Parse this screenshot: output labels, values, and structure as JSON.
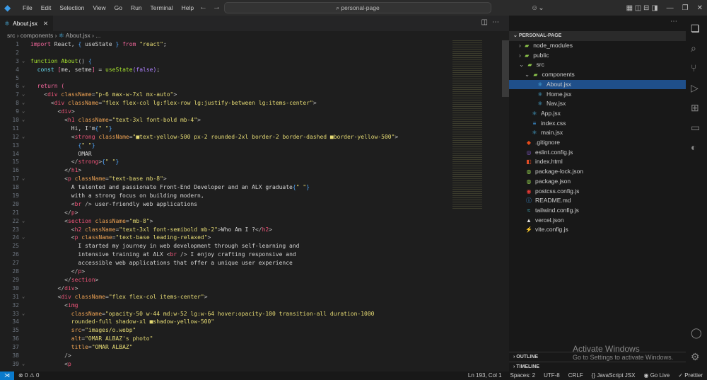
{
  "menu": [
    "File",
    "Edit",
    "Selection",
    "View",
    "Go",
    "Run",
    "Terminal",
    "Help"
  ],
  "search": "personal-page",
  "tab": {
    "label": "About.jsx"
  },
  "breadcrumb": [
    "src",
    "components",
    "About.jsx",
    "..."
  ],
  "code": [
    [
      [
        "k",
        "import"
      ],
      [
        "x",
        " React, "
      ],
      [
        "b",
        "{"
      ],
      [
        "x",
        " useState "
      ],
      [
        "b",
        "}"
      ],
      [
        "x",
        " "
      ],
      [
        "k",
        "from"
      ],
      [
        "x",
        " "
      ],
      [
        "s",
        "\"react\""
      ],
      [
        "x",
        ";"
      ]
    ],
    [],
    [
      [
        "f",
        "function"
      ],
      [
        "x",
        " "
      ],
      [
        "f",
        "About"
      ],
      [
        "p",
        "() "
      ],
      [
        "b",
        "{"
      ]
    ],
    [
      [
        "x",
        "  "
      ],
      [
        "c",
        "const"
      ],
      [
        "x",
        " "
      ],
      [
        "k",
        "["
      ],
      [
        "x",
        "me, setme"
      ],
      [
        "k",
        "]"
      ],
      [
        "x",
        " = "
      ],
      [
        "f",
        "useState"
      ],
      [
        "v",
        "("
      ],
      [
        "v",
        "false"
      ],
      [
        "v",
        ")"
      ],
      [
        "x",
        ";"
      ]
    ],
    [],
    [
      [
        "x",
        "  "
      ],
      [
        "k",
        "return"
      ],
      [
        "x",
        " "
      ],
      [
        "k",
        "("
      ]
    ],
    [
      [
        "x",
        "    "
      ],
      [
        "p",
        "<"
      ],
      [
        "t",
        "div"
      ],
      [
        "x",
        " "
      ],
      [
        "a",
        "className"
      ],
      [
        "p",
        "="
      ],
      [
        "s",
        "\"p-6 max-w-7xl mx-auto\""
      ],
      [
        "p",
        ">"
      ]
    ],
    [
      [
        "x",
        "      "
      ],
      [
        "p",
        "<"
      ],
      [
        "t",
        "div"
      ],
      [
        "x",
        " "
      ],
      [
        "a",
        "className"
      ],
      [
        "p",
        "="
      ],
      [
        "s",
        "\"flex flex-col lg:flex-row lg:justify-between lg:items-center\""
      ],
      [
        "p",
        ">"
      ]
    ],
    [
      [
        "x",
        "        "
      ],
      [
        "p",
        "<"
      ],
      [
        "t",
        "div"
      ],
      [
        "p",
        ">"
      ]
    ],
    [
      [
        "x",
        "          "
      ],
      [
        "p",
        "<"
      ],
      [
        "t",
        "h1"
      ],
      [
        "x",
        " "
      ],
      [
        "a",
        "className"
      ],
      [
        "p",
        "="
      ],
      [
        "s",
        "\"text-3xl font-bold mb-4\""
      ],
      [
        "p",
        ">"
      ]
    ],
    [
      [
        "x",
        "            Hi, I'm"
      ],
      [
        "b",
        "{"
      ],
      [
        "s",
        "\" \""
      ],
      [
        "b",
        "}"
      ]
    ],
    [
      [
        "x",
        "            "
      ],
      [
        "p",
        "<"
      ],
      [
        "t",
        "strong"
      ],
      [
        "x",
        " "
      ],
      [
        "a",
        "className"
      ],
      [
        "p",
        "="
      ],
      [
        "s",
        "\"■text-yellow-500 px-2 rounded-2xl border-2 border-dashed ■border-yellow-500\""
      ],
      [
        "p",
        ">"
      ]
    ],
    [
      [
        "x",
        "              "
      ],
      [
        "b",
        "{"
      ],
      [
        "s",
        "\" \""
      ],
      [
        "b",
        "}"
      ]
    ],
    [
      [
        "x",
        "              OMAR"
      ]
    ],
    [
      [
        "x",
        "            "
      ],
      [
        "p",
        "</"
      ],
      [
        "t",
        "strong"
      ],
      [
        "p",
        ">"
      ],
      [
        "b",
        "{"
      ],
      [
        "s",
        "\" \""
      ],
      [
        "b",
        "}"
      ]
    ],
    [
      [
        "x",
        "          "
      ],
      [
        "p",
        "</"
      ],
      [
        "t",
        "h1"
      ],
      [
        "p",
        ">"
      ]
    ],
    [
      [
        "x",
        "          "
      ],
      [
        "p",
        "<"
      ],
      [
        "t",
        "p"
      ],
      [
        "x",
        " "
      ],
      [
        "a",
        "className"
      ],
      [
        "p",
        "="
      ],
      [
        "s",
        "\"text-base mb-8\""
      ],
      [
        "p",
        ">"
      ]
    ],
    [
      [
        "x",
        "            A talented and passionate Front-End Developer and an ALX graduate"
      ],
      [
        "b",
        "{"
      ],
      [
        "s",
        "\" \""
      ],
      [
        "b",
        "}"
      ]
    ],
    [
      [
        "x",
        "            with a strong focus on building modern,"
      ]
    ],
    [
      [
        "x",
        "            "
      ],
      [
        "p",
        "<"
      ],
      [
        "t",
        "br"
      ],
      [
        "p",
        " />"
      ],
      [
        "x",
        " user-friendly web applications"
      ]
    ],
    [
      [
        "x",
        "          "
      ],
      [
        "p",
        "</"
      ],
      [
        "t",
        "p"
      ],
      [
        "p",
        ">"
      ]
    ],
    [
      [
        "x",
        "          "
      ],
      [
        "p",
        "<"
      ],
      [
        "t",
        "section"
      ],
      [
        "x",
        " "
      ],
      [
        "a",
        "className"
      ],
      [
        "p",
        "="
      ],
      [
        "s",
        "\"mb-8\""
      ],
      [
        "p",
        ">"
      ]
    ],
    [
      [
        "x",
        "            "
      ],
      [
        "p",
        "<"
      ],
      [
        "t",
        "h2"
      ],
      [
        "x",
        " "
      ],
      [
        "a",
        "className"
      ],
      [
        "p",
        "="
      ],
      [
        "s",
        "\"text-3xl font-semibold mb-2\""
      ],
      [
        "p",
        ">"
      ],
      [
        "x",
        "Who Am I ?"
      ],
      [
        "p",
        "</"
      ],
      [
        "t",
        "h2"
      ],
      [
        "p",
        ">"
      ]
    ],
    [
      [
        "x",
        "            "
      ],
      [
        "p",
        "<"
      ],
      [
        "t",
        "p"
      ],
      [
        "x",
        " "
      ],
      [
        "a",
        "className"
      ],
      [
        "p",
        "="
      ],
      [
        "s",
        "\"text-base leading-relaxed\""
      ],
      [
        "p",
        ">"
      ]
    ],
    [
      [
        "x",
        "              I started my journey in web development through self-learning and"
      ]
    ],
    [
      [
        "x",
        "              intensive training at ALX "
      ],
      [
        "p",
        "<"
      ],
      [
        "t",
        "br"
      ],
      [
        "p",
        " />"
      ],
      [
        "x",
        " I enjoy crafting responsive and"
      ]
    ],
    [
      [
        "x",
        "              accessible web applications that offer a unique user experience"
      ]
    ],
    [
      [
        "x",
        "            "
      ],
      [
        "p",
        "</"
      ],
      [
        "t",
        "p"
      ],
      [
        "p",
        ">"
      ]
    ],
    [
      [
        "x",
        "          "
      ],
      [
        "p",
        "</"
      ],
      [
        "t",
        "section"
      ],
      [
        "p",
        ">"
      ]
    ],
    [
      [
        "x",
        "        "
      ],
      [
        "p",
        "</"
      ],
      [
        "t",
        "div"
      ],
      [
        "p",
        ">"
      ]
    ],
    [
      [
        "x",
        "        "
      ],
      [
        "p",
        "<"
      ],
      [
        "t",
        "div"
      ],
      [
        "x",
        " "
      ],
      [
        "a",
        "className"
      ],
      [
        "p",
        "="
      ],
      [
        "s",
        "\"flex flex-col items-center\""
      ],
      [
        "p",
        ">"
      ]
    ],
    [
      [
        "x",
        "          "
      ],
      [
        "p",
        "<"
      ],
      [
        "t",
        "img"
      ]
    ],
    [
      [
        "x",
        "            "
      ],
      [
        "a",
        "className"
      ],
      [
        "p",
        "="
      ],
      [
        "s",
        "\"opacity-50 w-44 md:w-52 lg:w-64 hover:opacity-100 transition-all duration-1000"
      ]
    ],
    [
      [
        "s",
        "            rounded-full shadow-xl ■shadow-yellow-500\""
      ]
    ],
    [
      [
        "x",
        "            "
      ],
      [
        "a",
        "src"
      ],
      [
        "p",
        "="
      ],
      [
        "s",
        "\"images/o.webp\""
      ]
    ],
    [
      [
        "x",
        "            "
      ],
      [
        "a",
        "alt"
      ],
      [
        "p",
        "="
      ],
      [
        "s",
        "\"OMAR ALBAZ's photo\""
      ]
    ],
    [
      [
        "x",
        "            "
      ],
      [
        "a",
        "title"
      ],
      [
        "p",
        "="
      ],
      [
        "s",
        "\"OMAR ALBAZ\""
      ]
    ],
    [
      [
        "x",
        "          "
      ],
      [
        "p",
        "/>"
      ]
    ],
    [
      [
        "x",
        "          "
      ],
      [
        "p",
        "<"
      ],
      [
        "t",
        "p"
      ]
    ]
  ],
  "folds": [
    3,
    6,
    7,
    8,
    9,
    10,
    12,
    17,
    22,
    24,
    31,
    33,
    39
  ],
  "explorer": {
    "project": "PERSONAL-PAGE",
    "items": [
      {
        "name": "node_modules",
        "icon": "folder",
        "depth": 0,
        "chev": "›"
      },
      {
        "name": "public",
        "icon": "folder",
        "depth": 0,
        "chev": "›"
      },
      {
        "name": "src",
        "icon": "folder",
        "depth": 0,
        "chev": "⌄"
      },
      {
        "name": "components",
        "icon": "folder",
        "depth": 1,
        "chev": "⌄"
      },
      {
        "name": "About.jsx",
        "icon": "react",
        "depth": 2,
        "selected": true
      },
      {
        "name": "Home.jsx",
        "icon": "react",
        "depth": 2
      },
      {
        "name": "Nav.jsx",
        "icon": "react",
        "depth": 2
      },
      {
        "name": "App.jsx",
        "icon": "react",
        "depth": 1
      },
      {
        "name": "index.css",
        "icon": "css",
        "depth": 1
      },
      {
        "name": "main.jsx",
        "icon": "react",
        "depth": 1
      },
      {
        "name": ".gitignore",
        "icon": "git",
        "depth": 0
      },
      {
        "name": "eslint.config.js",
        "icon": "eslint",
        "depth": 0
      },
      {
        "name": "index.html",
        "icon": "html",
        "depth": 0
      },
      {
        "name": "package-lock.json",
        "icon": "npm",
        "depth": 0
      },
      {
        "name": "package.json",
        "icon": "npm",
        "depth": 0
      },
      {
        "name": "postcss.config.js",
        "icon": "postcss",
        "depth": 0
      },
      {
        "name": "README.md",
        "icon": "info",
        "depth": 0
      },
      {
        "name": "tailwind.config.js",
        "icon": "tailwind",
        "depth": 0
      },
      {
        "name": "vercel.json",
        "icon": "vercel",
        "depth": 0
      },
      {
        "name": "vite.config.js",
        "icon": "vite",
        "depth": 0
      }
    ],
    "outline": "OUTLINE",
    "timeline": "TIMELINE"
  },
  "watermark": {
    "title": "Activate Windows",
    "sub": "Go to Settings to activate Windows."
  },
  "status": {
    "errors": "0",
    "warnings": "0",
    "position": "Ln 193, Col 1",
    "spaces": "Spaces: 2",
    "encoding": "UTF-8",
    "eol": "CRLF",
    "language": "JavaScript JSX",
    "golive": "Go Live",
    "prettier": "Prettier"
  }
}
